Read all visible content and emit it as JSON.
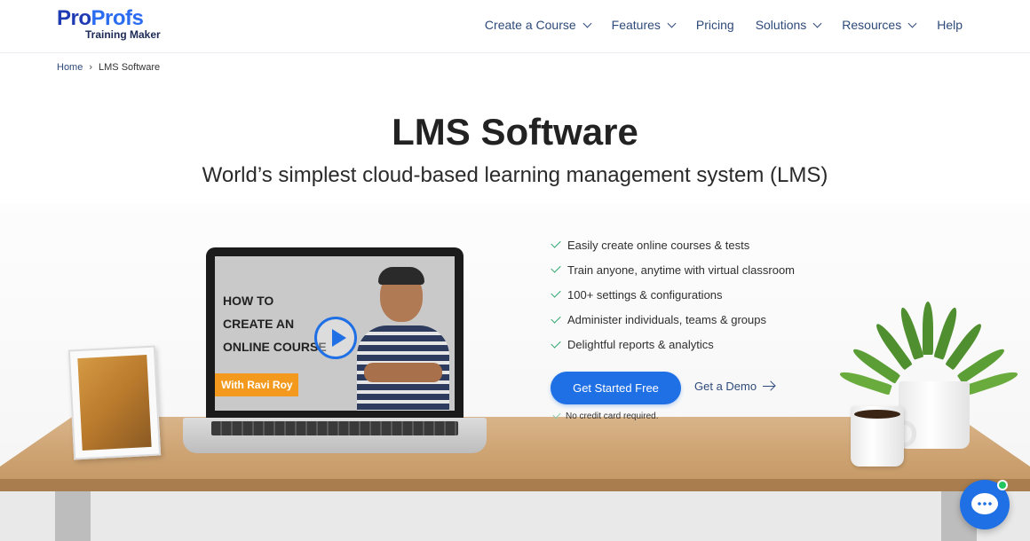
{
  "brand": {
    "logo_part1": "Pro",
    "logo_part2": "Profs",
    "logo_sub": "Training Maker",
    "primary_color": "#1f6fe5",
    "nav_color": "#2e4a7a",
    "check_color": "#2aa56b"
  },
  "nav": {
    "items": [
      {
        "label": "Create a Course",
        "has_dropdown": true
      },
      {
        "label": "Features",
        "has_dropdown": true
      },
      {
        "label": "Pricing",
        "has_dropdown": false
      },
      {
        "label": "Solutions",
        "has_dropdown": true
      },
      {
        "label": "Resources",
        "has_dropdown": true
      },
      {
        "label": "Help",
        "has_dropdown": false
      }
    ]
  },
  "breadcrumb": {
    "home": "Home",
    "separator": "›",
    "current": "LMS Software"
  },
  "hero": {
    "title": "LMS Software",
    "subtitle": "World’s simplest cloud-based learning management system (LMS)"
  },
  "video": {
    "lines": [
      "HOW TO",
      "CREATE AN",
      "ONLINE COURSE"
    ],
    "tag": "With Ravi Roy"
  },
  "features": [
    "Easily create online courses & tests",
    "Train anyone, anytime with virtual classroom",
    "100+ settings & configurations",
    "Administer individuals, teams & groups",
    "Delightful reports & analytics"
  ],
  "cta": {
    "primary": "Get Started Free",
    "secondary": "Get a Demo",
    "note": "No credit card required."
  },
  "icons": {
    "check": "check-icon",
    "play": "play-icon",
    "chat": "chat-icon",
    "arrow": "arrow-right-icon",
    "dropdown": "chevron-down-icon"
  }
}
